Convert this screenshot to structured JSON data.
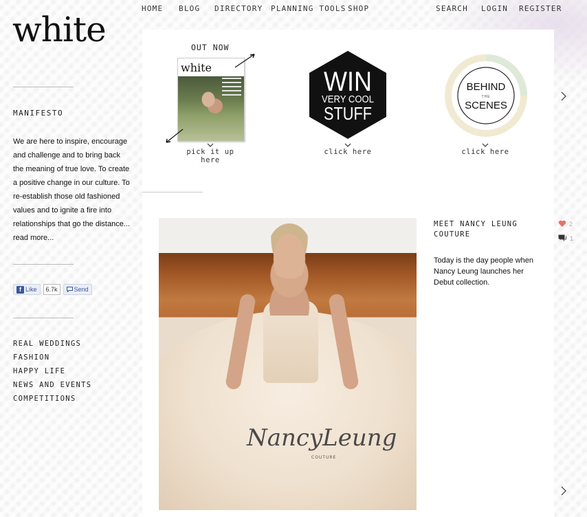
{
  "site": {
    "logo": "white"
  },
  "nav": {
    "items": [
      "HOME",
      "BLOG",
      "DIRECTORY",
      "PLANNING TOOLS",
      "SHOP"
    ],
    "utility": [
      "SEARCH",
      "LOGIN",
      "REGISTER"
    ]
  },
  "sidebar": {
    "manifesto_heading": "MANIFESTO",
    "manifesto_text": "We are here to inspire, encourage and challenge and to bring back the meaning of true love. To create a positive change in our culture. To re-establish those old fashioned values and to ignite a fire into relationships that go the distance...",
    "read_more": "read more...",
    "social": {
      "like_label": "Like",
      "like_count": "6.7k",
      "send_label": "Send"
    },
    "categories": [
      "REAL WEDDINGS",
      "FASHION",
      "HAPPY LIFE",
      "NEWS AND EVENTS",
      "COMPETITIONS"
    ]
  },
  "promos": {
    "issue": {
      "heading": "OUT NOW",
      "cover_title": "white",
      "caption": "pick it up here"
    },
    "win": {
      "line1": "WIN",
      "line2": "VERY COOL",
      "line3": "STUFF",
      "caption": "click here"
    },
    "behind": {
      "line1": "BEHIND",
      "line2": "THE",
      "line3": "SCENES",
      "caption": "click here"
    }
  },
  "post": {
    "title": "MEET NANCY LEUNG COUTURE",
    "excerpt": "Today is the day people when Nancy Leung launches her Debut collection.",
    "image_signature": "NancyLeung",
    "image_signature_sub": "COUTURE",
    "likes": "2",
    "comments": "1"
  },
  "colors": {
    "heart": "#e8736b",
    "comment_icon": "#333333",
    "hex_badge": "#111111"
  }
}
